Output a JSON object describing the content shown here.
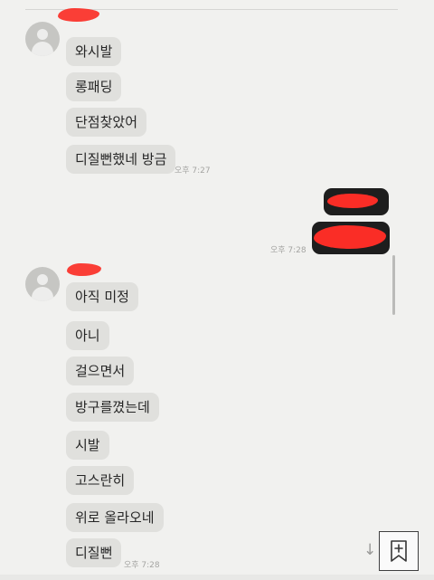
{
  "chat": {
    "incoming_1": {
      "messages": [
        "와시발",
        "롱패딩",
        "단점찾았어",
        "디질뻔했네 방금"
      ],
      "time": "오후 7:27"
    },
    "outgoing": {
      "time": "오후 7:28"
    },
    "incoming_2": {
      "messages": [
        "아직 미정",
        "아니",
        "걸으면서",
        "방구를꼈는데",
        "시발",
        "고스란히",
        "위로 올라오네",
        "디질뻔"
      ],
      "time": "오후 7:28"
    }
  },
  "icons": {
    "avatar": "default-profile-icon",
    "scroll_down": "down-arrow-icon",
    "bookmark": "bookmark-add-icon"
  },
  "colors": {
    "background": "#f6f6f4",
    "incoming_bubble": "#e4e4e1",
    "outgoing_bubble": "#1a1a1a",
    "redaction": "#ff2a22",
    "timestamp": "#a6a6a3"
  }
}
